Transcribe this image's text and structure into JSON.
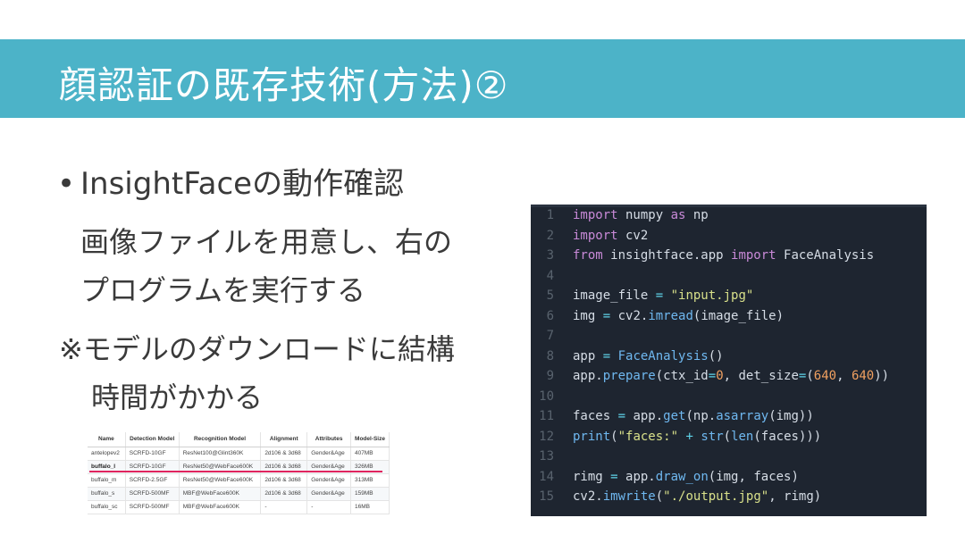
{
  "slide": {
    "title": "顔認証の既存技術(方法)②",
    "bullet": "InsightFaceの動作確認",
    "bullet_marker": "•",
    "description_line1": "画像ファイルを用意し、右の",
    "description_line2": "プログラムを実行する",
    "note_line1": "※モデルのダウンロードに結構",
    "note_line2": "時間がかかる",
    "colors": {
      "title_bar": "#4cb3c8",
      "title_text": "#ffffff",
      "highlight_underline": "#e0245e",
      "code_background": "#1e2530"
    }
  },
  "model_table": {
    "columns": [
      "Name",
      "Detection Model",
      "Recognition Model",
      "Alignment",
      "Attributes",
      "Model-Size"
    ],
    "rows": [
      [
        "antelopev2",
        "SCRFD-10GF",
        "ResNet100@Glint360K",
        "2d106 & 3d68",
        "Gender&Age",
        "407MB"
      ],
      [
        "buffalo_l",
        "SCRFD-10GF",
        "ResNet50@WebFace600K",
        "2d106 & 3d68",
        "Gender&Age",
        "326MB"
      ],
      [
        "buffalo_m",
        "SCRFD-2.5GF",
        "ResNet50@WebFace600K",
        "2d106 & 3d68",
        "Gender&Age",
        "313MB"
      ],
      [
        "buffalo_s",
        "SCRFD-500MF",
        "MBF@WebFace600K",
        "2d106 & 3d68",
        "Gender&Age",
        "159MB"
      ],
      [
        "buffalo_sc",
        "SCRFD-500MF",
        "MBF@WebFace600K",
        "-",
        "-",
        "16MB"
      ]
    ],
    "highlighted_row": "buffalo_l"
  },
  "code": {
    "lines": [
      {
        "n": "1",
        "tokens": [
          [
            "kw",
            "import"
          ],
          [
            "plain",
            " numpy "
          ],
          [
            "kw",
            "as"
          ],
          [
            "plain",
            " np"
          ]
        ]
      },
      {
        "n": "2",
        "tokens": [
          [
            "kw",
            "import"
          ],
          [
            "plain",
            " cv2"
          ]
        ]
      },
      {
        "n": "3",
        "tokens": [
          [
            "kw",
            "from"
          ],
          [
            "plain",
            " insightface.app "
          ],
          [
            "kw",
            "import"
          ],
          [
            "plain",
            " FaceAnalysis"
          ]
        ]
      },
      {
        "n": "4",
        "tokens": []
      },
      {
        "n": "5",
        "tokens": [
          [
            "plain",
            "image_file "
          ],
          [
            "op",
            "="
          ],
          [
            "plain",
            " "
          ],
          [
            "str",
            "\"input.jpg\""
          ]
        ]
      },
      {
        "n": "6",
        "tokens": [
          [
            "plain",
            "img "
          ],
          [
            "op",
            "="
          ],
          [
            "plain",
            " cv2."
          ],
          [
            "fn",
            "imread"
          ],
          [
            "plain",
            "(image_file)"
          ]
        ]
      },
      {
        "n": "7",
        "tokens": []
      },
      {
        "n": "8",
        "tokens": [
          [
            "plain",
            "app "
          ],
          [
            "op",
            "="
          ],
          [
            "plain",
            " "
          ],
          [
            "fn",
            "FaceAnalysis"
          ],
          [
            "plain",
            "()"
          ]
        ]
      },
      {
        "n": "9",
        "tokens": [
          [
            "plain",
            "app."
          ],
          [
            "fn",
            "prepare"
          ],
          [
            "plain",
            "(ctx_id"
          ],
          [
            "op",
            "="
          ],
          [
            "num",
            "0"
          ],
          [
            "plain",
            ", det_size"
          ],
          [
            "op",
            "="
          ],
          [
            "plain",
            "("
          ],
          [
            "num",
            "640"
          ],
          [
            "plain",
            ", "
          ],
          [
            "num",
            "640"
          ],
          [
            "plain",
            "))"
          ]
        ]
      },
      {
        "n": "10",
        "tokens": []
      },
      {
        "n": "11",
        "tokens": [
          [
            "plain",
            "faces "
          ],
          [
            "op",
            "="
          ],
          [
            "plain",
            " app."
          ],
          [
            "fn",
            "get"
          ],
          [
            "plain",
            "(np."
          ],
          [
            "fn",
            "asarray"
          ],
          [
            "plain",
            "(img))"
          ]
        ]
      },
      {
        "n": "12",
        "tokens": [
          [
            "fn",
            "print"
          ],
          [
            "plain",
            "("
          ],
          [
            "str",
            "\"faces:\""
          ],
          [
            "plain",
            " "
          ],
          [
            "op",
            "+"
          ],
          [
            "plain",
            " "
          ],
          [
            "fn",
            "str"
          ],
          [
            "plain",
            "("
          ],
          [
            "fn",
            "len"
          ],
          [
            "plain",
            "(faces)))"
          ]
        ]
      },
      {
        "n": "13",
        "tokens": []
      },
      {
        "n": "14",
        "tokens": [
          [
            "plain",
            "rimg "
          ],
          [
            "op",
            "="
          ],
          [
            "plain",
            " app."
          ],
          [
            "fn",
            "draw_on"
          ],
          [
            "plain",
            "(img, faces)"
          ]
        ]
      },
      {
        "n": "15",
        "tokens": [
          [
            "plain",
            "cv2."
          ],
          [
            "fn",
            "imwrite"
          ],
          [
            "plain",
            "("
          ],
          [
            "str",
            "\"./output.jpg\""
          ],
          [
            "plain",
            ", rimg)"
          ]
        ]
      }
    ]
  }
}
